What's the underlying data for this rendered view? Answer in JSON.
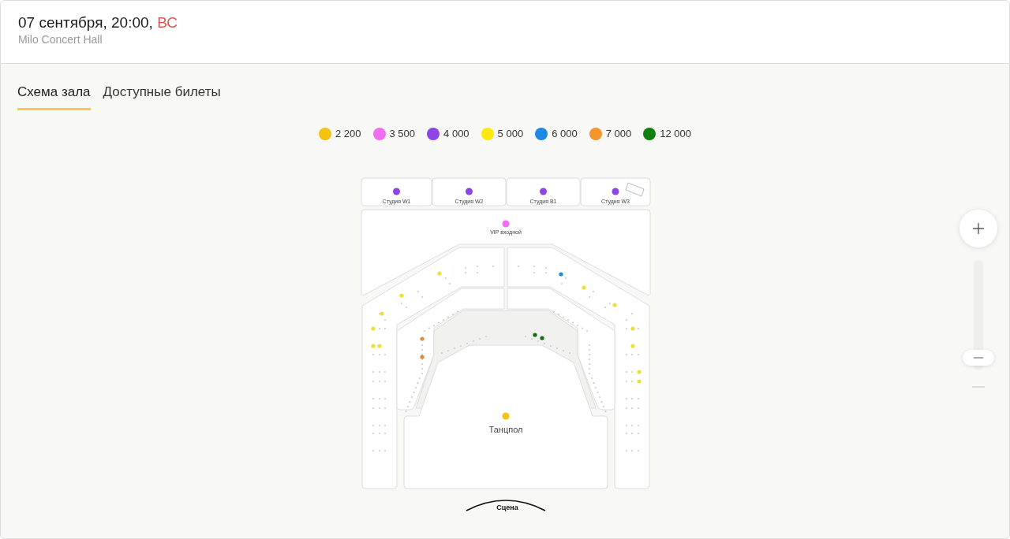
{
  "header": {
    "date": "07 сентября, 20:00,",
    "weekday": "ВС",
    "venue": "Milo Concert Hall"
  },
  "tabs": [
    {
      "label": "Схема зала",
      "selected": true
    },
    {
      "label": "Доступные билеты",
      "selected": false
    }
  ],
  "legend": [
    {
      "price": "2 200",
      "color": "#f5c211"
    },
    {
      "price": "3 500",
      "color": "#f06ef0"
    },
    {
      "price": "4 000",
      "color": "#8e44e6"
    },
    {
      "price": "5 000",
      "color": "#ffe70f"
    },
    {
      "price": "6 000",
      "color": "#1e88e5"
    },
    {
      "price": "7 000",
      "color": "#f5962a"
    },
    {
      "price": "12 000",
      "color": "#108010"
    }
  ],
  "map": {
    "studios": [
      {
        "label": "Студия W1",
        "color": "#8e44e6"
      },
      {
        "label": "Студия W2",
        "color": "#8e44e6"
      },
      {
        "label": "Студия B1",
        "color": "#8e44e6"
      },
      {
        "label": "Студия W3",
        "color": "#8e44e6"
      }
    ],
    "vip": {
      "label": "VIP входной",
      "color": "#f06ef0"
    },
    "dance_floor": {
      "label": "Танцпол",
      "color": "#f5c211"
    },
    "stage": "Сцена",
    "seats": [
      {
        "color": "#ece03a"
      },
      {
        "color": "#ece03a"
      },
      {
        "color": "#ece03a"
      },
      {
        "color": "#ece03a"
      },
      {
        "color": "#ece03a"
      },
      {
        "color": "#ece03a"
      },
      {
        "color": "#ece03a"
      },
      {
        "color": "#ece03a"
      },
      {
        "color": "#ece03a"
      },
      {
        "color": "#ece03a"
      },
      {
        "color": "#ece03a"
      },
      {
        "color": "#ece03a"
      },
      {
        "color": "#1e88e5"
      },
      {
        "color": "#e08a3a"
      },
      {
        "color": "#e08a3a"
      },
      {
        "color": "#106e10"
      },
      {
        "color": "#106e10"
      }
    ]
  }
}
